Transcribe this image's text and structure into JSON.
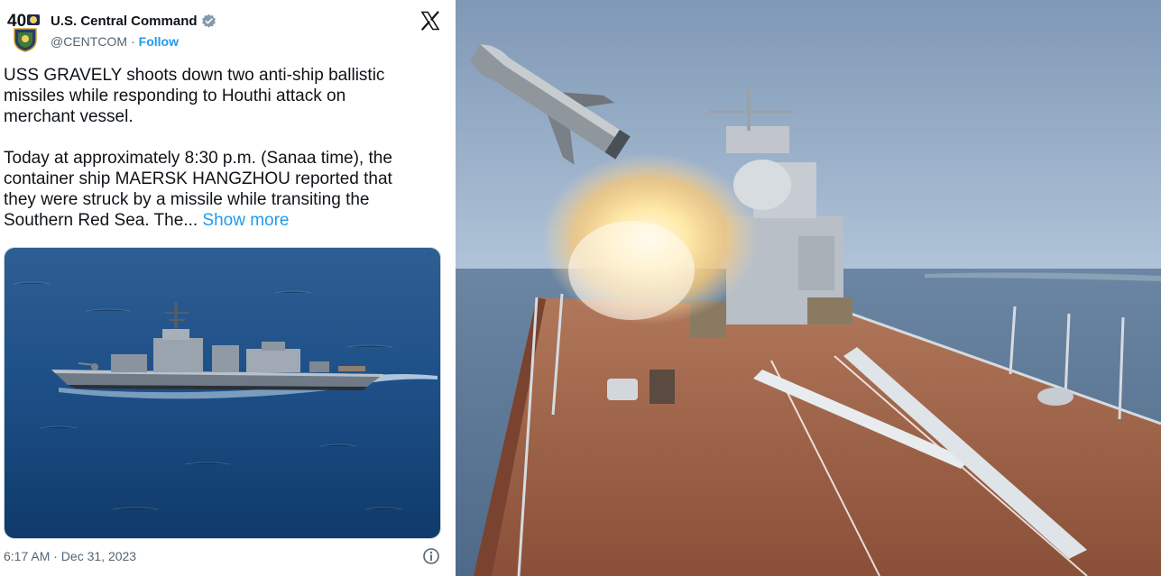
{
  "tweet": {
    "account_name": "U.S. Central Command",
    "avatar_badge": "40",
    "handle": "@CENTCOM",
    "separator": "·",
    "follow_label": "Follow",
    "body_line1": "USS GRAVELY shoots down two anti-ship ballistic",
    "body_line2": "missiles while responding to Houthi attack on",
    "body_line3": "merchant vessel.",
    "body_line4": "Today at approximately 8:30 p.m. (Sanaa time), the",
    "body_line5": "container ship MAERSK HANGZHOU reported that",
    "body_line6": "they were struck by a missile while transiting the",
    "body_line7": "Southern Red Sea. The...",
    "show_more": "Show more",
    "timestamp": "6:17 AM · Dec 31, 2023",
    "icons": {
      "platform": "x-logo-icon",
      "verified": "verified-badge-icon",
      "info": "info-icon"
    },
    "colors": {
      "link": "#1d9bf0",
      "secondary_text": "#536471",
      "primary_text": "#0f1419"
    }
  }
}
